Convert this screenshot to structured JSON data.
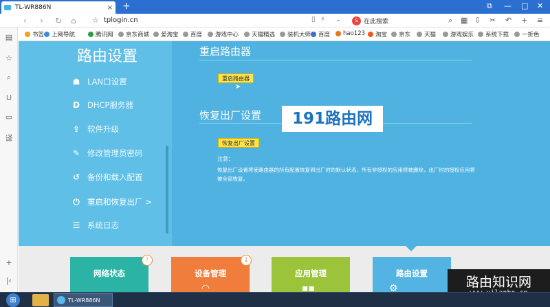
{
  "browser": {
    "tab_title": "TL-WR886N",
    "tab_close": "×",
    "new_tab": "+",
    "url": "tplogin.cn",
    "search_placeholder": "在此搜索",
    "search_logo": "S",
    "window_controls": [
      "⧉",
      "—",
      "□",
      "✕"
    ]
  },
  "bookmarks": [
    {
      "label": "书签",
      "color": "#f0a020"
    },
    {
      "label": "上网导航",
      "color": "#3b8de0"
    },
    {
      "label": "腾讯网",
      "color": "#2a9f4a"
    },
    {
      "label": "京东商城",
      "color": "#999999"
    },
    {
      "label": "爱淘宝",
      "color": "#999999"
    },
    {
      "label": "百度",
      "color": "#999999"
    },
    {
      "label": "游戏中心",
      "color": "#999999"
    },
    {
      "label": "天猫精选",
      "color": "#999999"
    },
    {
      "label": "装机大师",
      "color": "#999999"
    },
    {
      "label": "百度",
      "color": "#3b6fd0"
    },
    {
      "label": "hao123",
      "color": "#e07a1b"
    },
    {
      "label": "淘宝",
      "color": "#f05a1a"
    },
    {
      "label": "京东",
      "color": "#999999"
    },
    {
      "label": "天猫",
      "color": "#999999"
    },
    {
      "label": "游戏娱乐",
      "color": "#999999"
    },
    {
      "label": "系统下载",
      "color": "#999999"
    },
    {
      "label": "一折色",
      "color": "#999999"
    }
  ],
  "router": {
    "side_title": "路由设置",
    "menu": [
      {
        "icon": "lan-icon",
        "glyph": "☗",
        "label": "LAN口设置"
      },
      {
        "icon": "dhcp-icon",
        "glyph": "D",
        "label": "DHCP服务器"
      },
      {
        "icon": "upgrade-icon",
        "glyph": "⇪",
        "label": "软件升级"
      },
      {
        "icon": "password-icon",
        "glyph": "✎",
        "label": "修改管理员密码"
      },
      {
        "icon": "backup-icon",
        "glyph": "↺",
        "label": "备份和载入配置"
      },
      {
        "icon": "power-icon",
        "glyph": "⏻",
        "label": "重启和恢复出厂 >"
      },
      {
        "icon": "log-icon",
        "glyph": "☰",
        "label": "系统日志"
      }
    ],
    "reboot": {
      "title": "重启路由器",
      "button": "重启路由器"
    },
    "factory": {
      "title": "恢复出厂设置",
      "button": "恢复出厂设置",
      "note_label": "注意：",
      "note_text": "恢复出厂设置将使路由器的所有配置恢复到出厂时的默认状态，所有非授权的应用将被删除，出厂时的授权应用将被全部恢复。"
    },
    "watermark": "191路由网"
  },
  "cards": [
    {
      "title": "网络状态",
      "color": "#2bb3a6",
      "badge": "!"
    },
    {
      "title": "设备管理",
      "color": "#f07d3b",
      "badge": "1"
    },
    {
      "title": "应用管理",
      "color": "#9bc43a",
      "badge": ""
    },
    {
      "title": "路由设置",
      "color": "#53b3e2",
      "badge": ""
    }
  ],
  "corner": {
    "title": "路由知识网",
    "url": "www.yilanbo.cn"
  },
  "taskbar": {
    "app_label": "TL-WR886N"
  }
}
